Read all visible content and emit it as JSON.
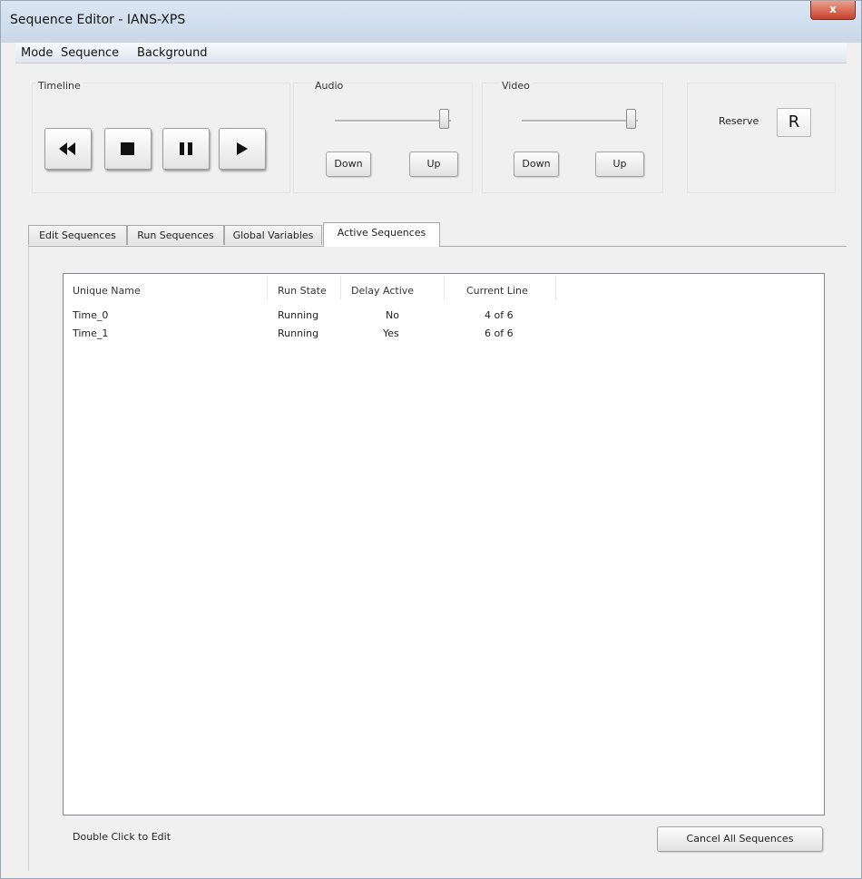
{
  "window": {
    "title": "Sequence Editor - IANS-XPS",
    "close_label": "x"
  },
  "menu": [
    "Mode",
    "Sequence",
    "Background"
  ],
  "timeline": {
    "label": "Timeline"
  },
  "audio": {
    "label": "Audio",
    "down": "Down",
    "up": "Up",
    "level": 1.0
  },
  "video": {
    "label": "Video",
    "down": "Down",
    "up": "Up",
    "level": 1.0
  },
  "reserve": {
    "label": "Reserve",
    "button": "R"
  },
  "tabs": [
    "Edit Sequences",
    "Run Sequences",
    "Global Variables",
    "Active Sequences"
  ],
  "active_tab": "Active Sequences",
  "table": {
    "columns": [
      "Unique Name",
      "Run State",
      "Delay Active",
      "Current Line"
    ],
    "rows": [
      [
        "Time_0",
        "Running",
        "No",
        "4 of 6"
      ],
      [
        "Time_1",
        "Running",
        "Yes",
        "6 of 6"
      ]
    ]
  },
  "footer": {
    "hint": "Double Click to Edit",
    "cancel_all": "Cancel All Sequences"
  },
  "icons": [
    "rewind-icon",
    "stop-icon",
    "pause-icon",
    "play-icon"
  ]
}
